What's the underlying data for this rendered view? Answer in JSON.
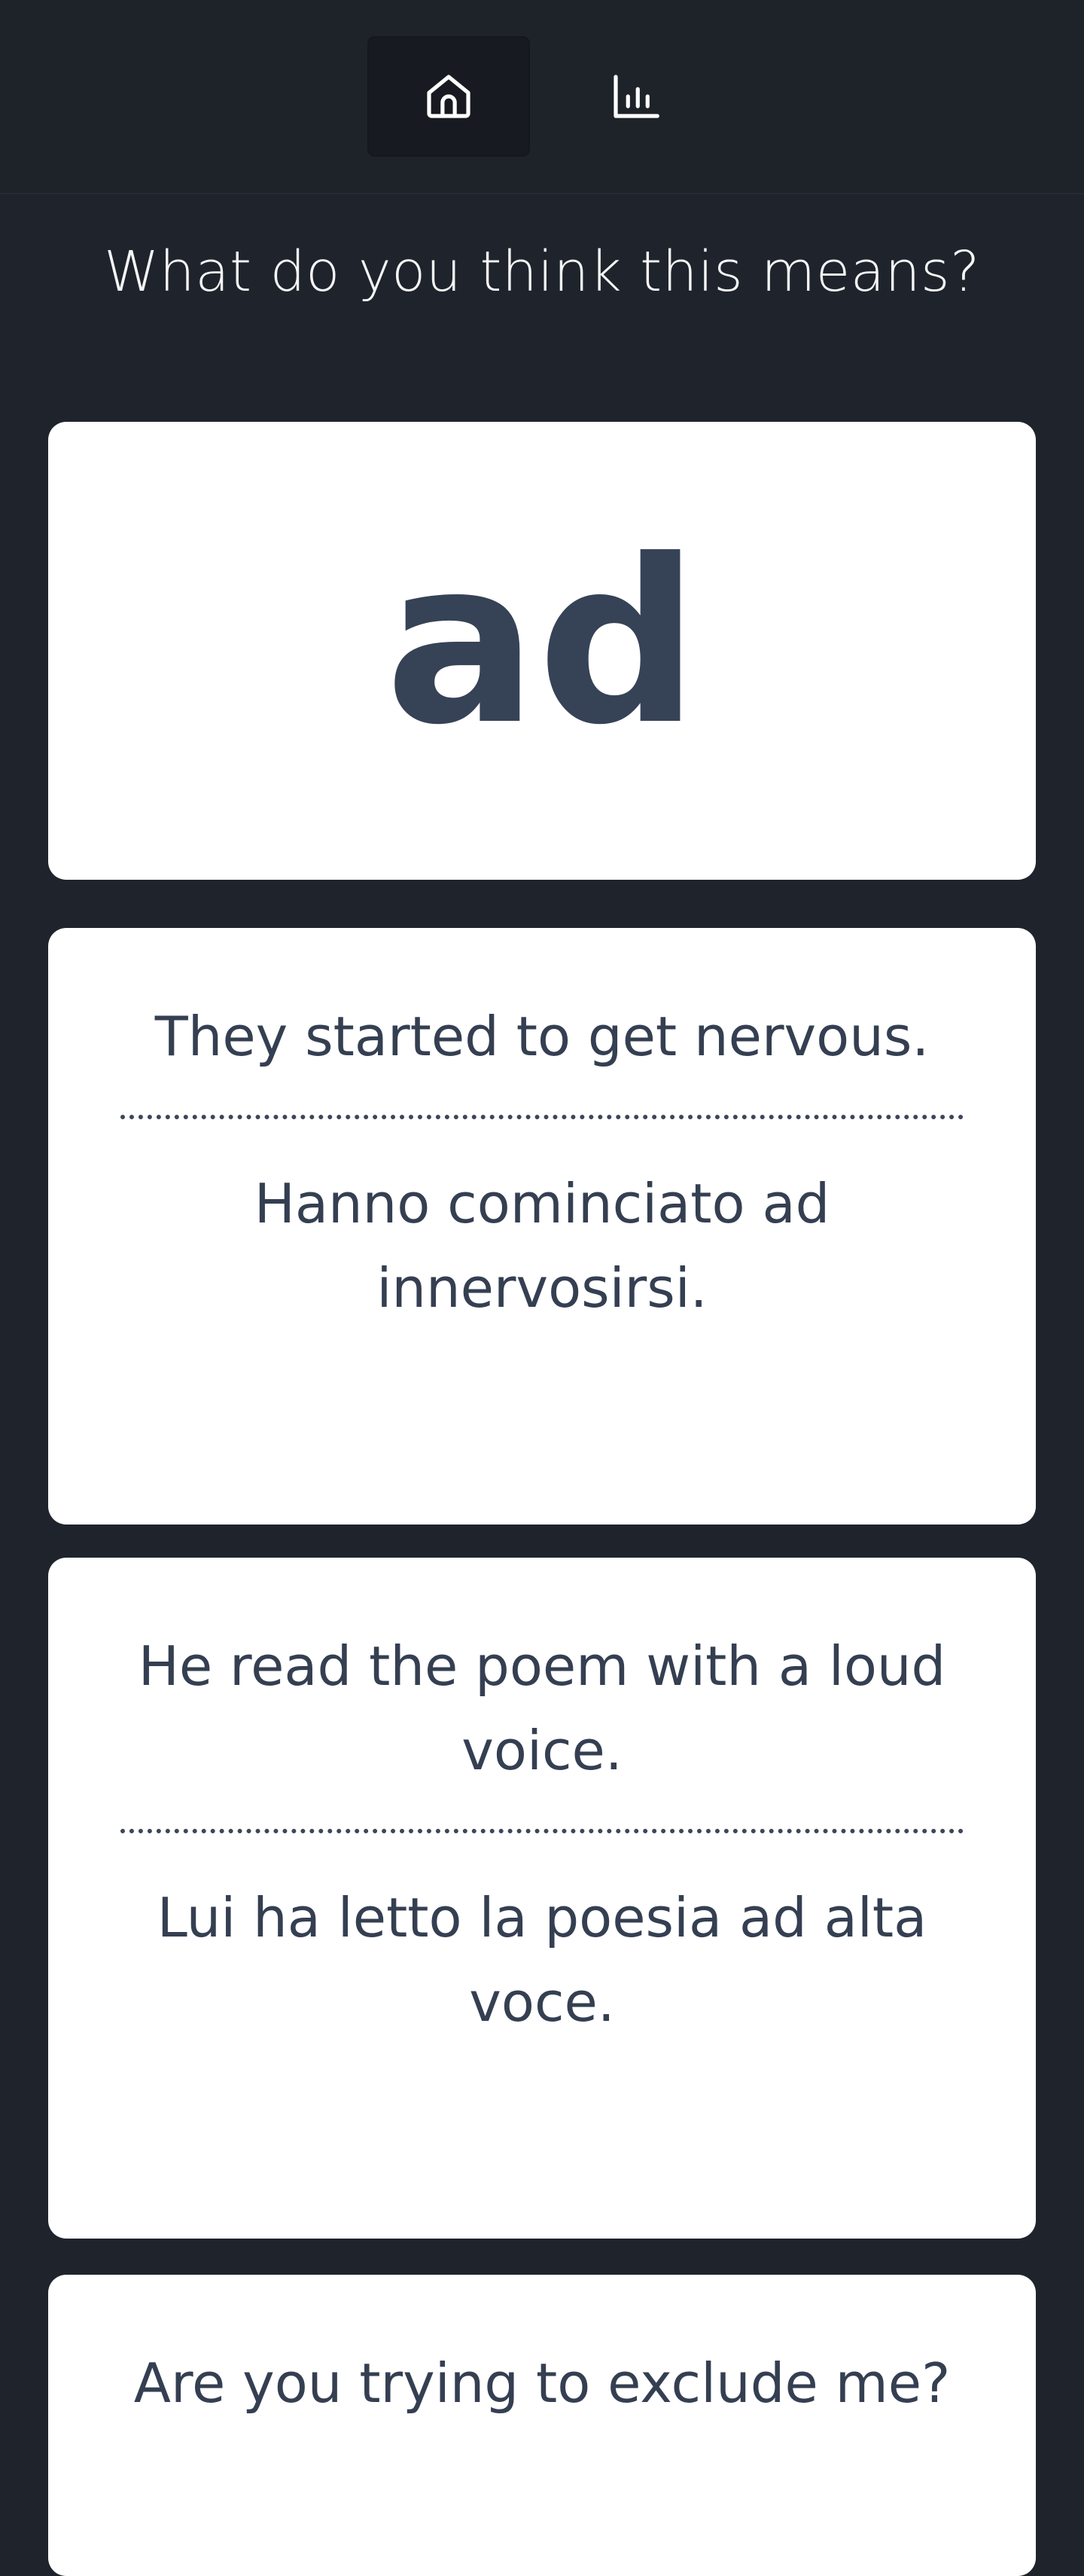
{
  "nav": {
    "items": [
      {
        "icon": "home-icon",
        "active": true
      },
      {
        "icon": "bar-chart-icon",
        "active": false
      }
    ]
  },
  "prompt": "What do you think this means?",
  "word": "ad",
  "examples": [
    {
      "en": "They started to get nervous.",
      "it": "Hanno cominciato ad innervosirsi."
    },
    {
      "en": "He read the poem with a loud voice.",
      "it": "Lui ha letto la poesia ad alta voce."
    },
    {
      "en": "Are you trying to exclude me?",
      "it": ""
    }
  ],
  "colors": {
    "background": "#1f242c",
    "card": "#ffffff",
    "text_dark": "#353f52",
    "text_light": "#f5f6f7"
  }
}
